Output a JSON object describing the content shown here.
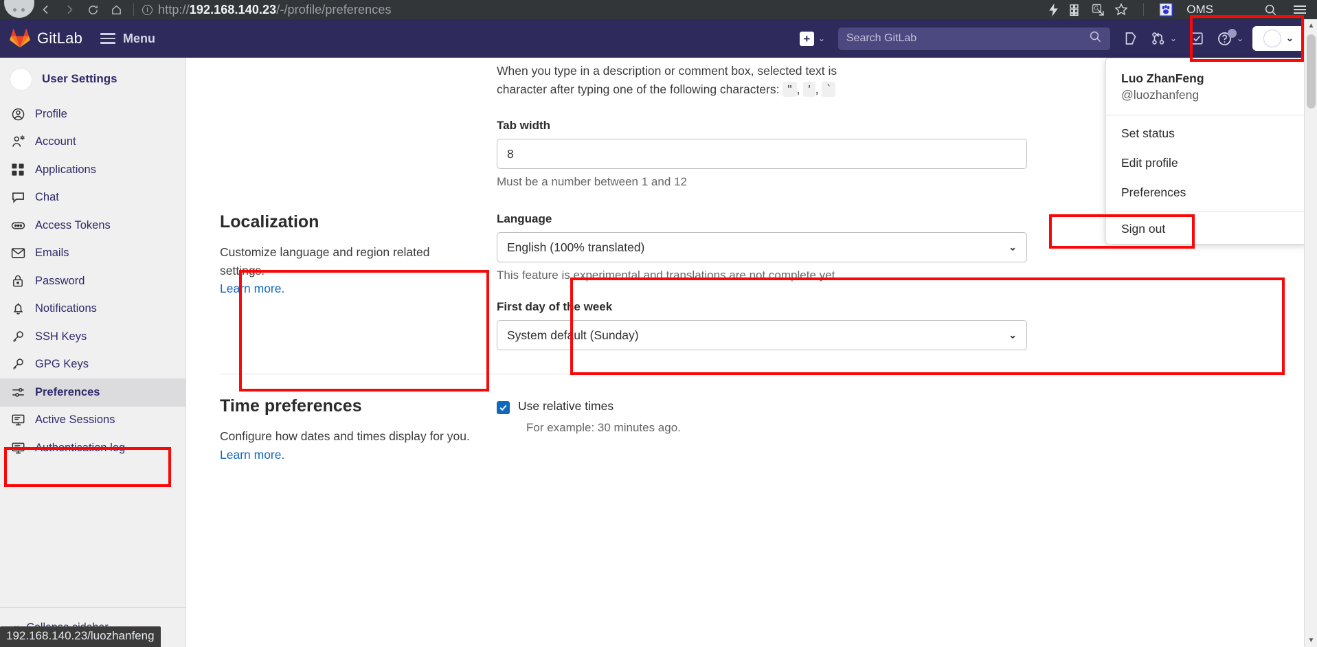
{
  "browser": {
    "url_prefix": "http://",
    "url_host": "192.168.140.23",
    "url_path": "/-/profile/preferences",
    "back_icon": "back-arrow-icon",
    "forward_icon": "forward-arrow-icon",
    "reload_icon": "reload-icon",
    "home_icon": "home-icon",
    "bookmark_label": "OMS"
  },
  "navbar": {
    "brand": "GitLab",
    "menu_label": "Menu",
    "search_placeholder": "Search GitLab"
  },
  "user_dropdown": {
    "name": "Luo ZhanFeng",
    "handle": "@luozhanfeng",
    "items": [
      {
        "label": "Set status"
      },
      {
        "label": "Edit profile"
      },
      {
        "label": "Preferences"
      },
      {
        "label": "Sign out"
      }
    ]
  },
  "sidebar": {
    "title": "User Settings",
    "items": [
      {
        "label": "Profile",
        "icon": "user-circle-icon",
        "active": false
      },
      {
        "label": "Account",
        "icon": "user-gear-icon",
        "active": false
      },
      {
        "label": "Applications",
        "icon": "grid-apps-icon",
        "active": false
      },
      {
        "label": "Chat",
        "icon": "chat-bubble-icon",
        "active": false
      },
      {
        "label": "Access Tokens",
        "icon": "token-icon",
        "active": false
      },
      {
        "label": "Emails",
        "icon": "envelope-icon",
        "active": false
      },
      {
        "label": "Password",
        "icon": "lock-icon",
        "active": false
      },
      {
        "label": "Notifications",
        "icon": "bell-icon",
        "active": false
      },
      {
        "label": "SSH Keys",
        "icon": "key-icon",
        "active": false
      },
      {
        "label": "GPG Keys",
        "icon": "key-icon",
        "active": false
      },
      {
        "label": "Preferences",
        "icon": "sliders-icon",
        "active": true
      },
      {
        "label": "Active Sessions",
        "icon": "monitor-icon",
        "active": false
      },
      {
        "label": "Authentication log",
        "icon": "monitor-log-icon",
        "active": false
      }
    ],
    "collapse_label": "Collapse sidebar"
  },
  "status_tooltip": "192.168.140.23/luozhanfeng",
  "main": {
    "behavior_text_line1": "When you type in a description or comment box, selected text is",
    "behavior_text_line2": "character after typing one of the following characters:",
    "behavior_chars": [
      "\"",
      "'",
      "`"
    ],
    "tab_width": {
      "label": "Tab width",
      "value": "8",
      "help": "Must be a number between 1 and 12"
    },
    "localization": {
      "title": "Localization",
      "description": "Customize language and region related settings.",
      "learn_more": "Learn more.",
      "language": {
        "label": "Language",
        "value": "English (100% translated)",
        "help": "This feature is experimental and translations are not complete yet."
      },
      "first_day": {
        "label": "First day of the week",
        "value": "System default (Sunday)"
      }
    },
    "time_preferences": {
      "title": "Time preferences",
      "description": "Configure how dates and times display for you.",
      "learn_more": "Learn more.",
      "relative_times_label": "Use relative times",
      "relative_times_help": "For example: 30 minutes ago.",
      "relative_times_checked": true
    }
  },
  "colors": {
    "navbar_bg": "#2e2a5b",
    "annotation": "#fb0707",
    "link": "#1068bf",
    "checkbox": "#1068bf",
    "sidebar_bg": "#f0f0f0",
    "active_item_bg": "#dcdcde"
  }
}
